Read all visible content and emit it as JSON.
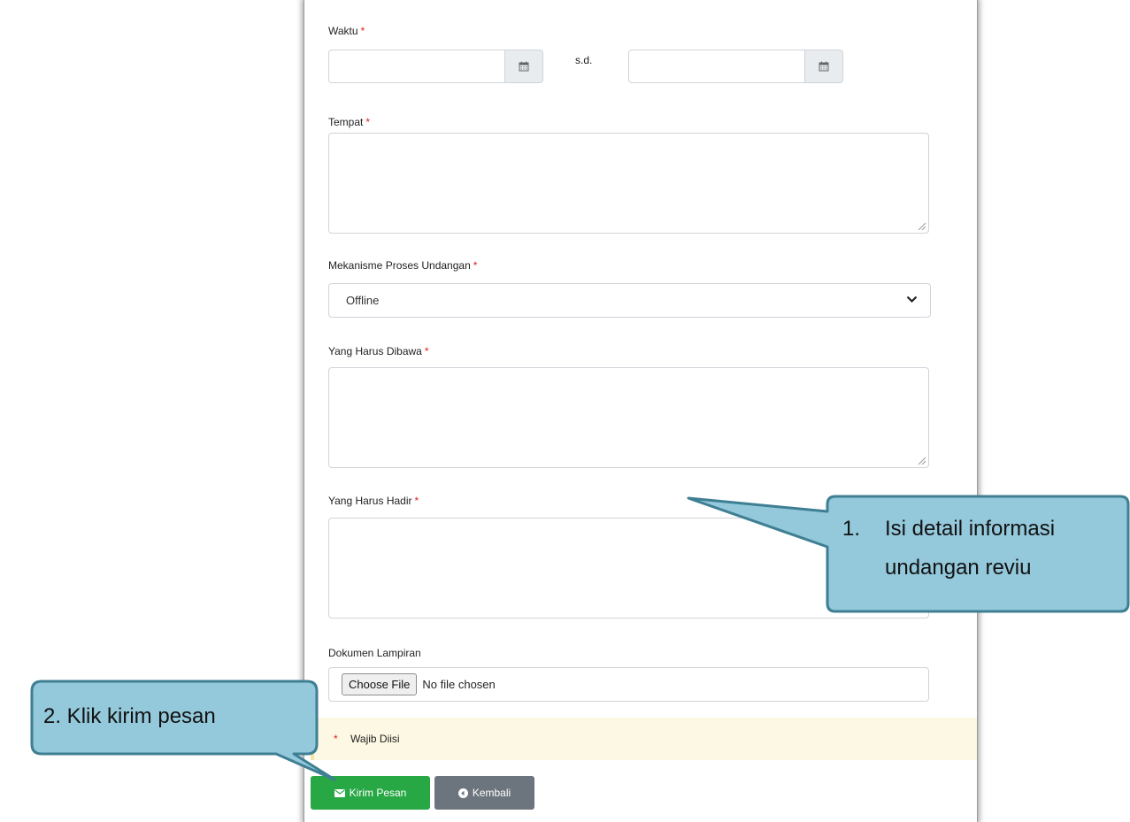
{
  "form": {
    "waktu_label": "Waktu",
    "required_mark": "*",
    "sd_label": "s.d.",
    "tempat_label": "Tempat",
    "mekanisme_label": "Mekanisme Proses Undangan",
    "mekanisme_value": "Offline",
    "dibawa_label": "Yang Harus Dibawa",
    "hadir_label": "Yang Harus Hadir",
    "lampiran_label": "Dokumen Lampiran",
    "choose_file_label": "Choose File",
    "file_status": "No file chosen",
    "wajib_note": "Wajib Diisi",
    "kirim_label": "Kirim Pesan",
    "kembali_label": "Kembali"
  },
  "callouts": {
    "step1_number": "1.",
    "step1_line1": "Isi detail informasi",
    "step1_line2": "undangan reviu",
    "step2": "2. Klik kirim pesan"
  },
  "colors": {
    "required": "#e02020",
    "callout_fill": "#94c8db",
    "callout_border": "#3f7f93",
    "green_button": "#28a745",
    "gray_button": "#6c757d",
    "note_bg": "#fcf8e3"
  },
  "icons": [
    "calendar-icon",
    "chevron-down-icon",
    "envelope-icon",
    "back-circle-icon",
    "resize-grip-icon"
  ]
}
